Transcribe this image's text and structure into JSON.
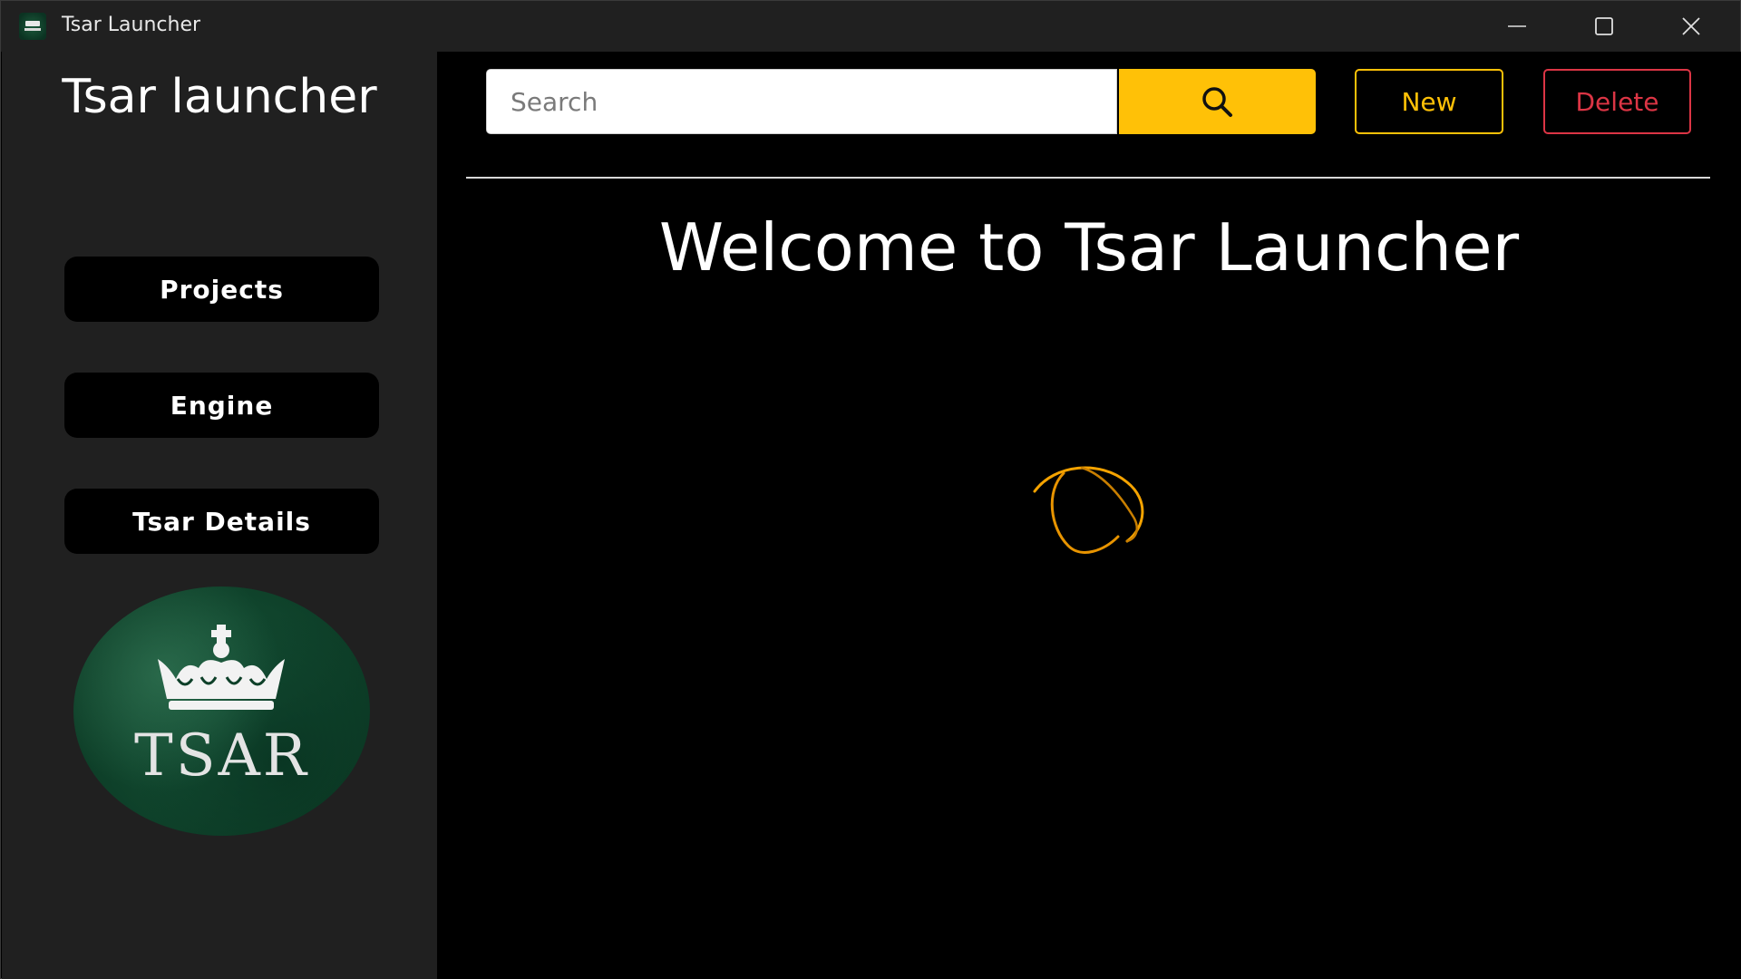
{
  "window": {
    "title": "Tsar Launcher",
    "icon": "tsar-app-icon",
    "controls": {
      "minimize": "minimize-icon",
      "maximize": "maximize-icon",
      "close": "close-icon"
    }
  },
  "sidebar": {
    "brand_title": "Tsar launcher",
    "items": [
      {
        "label": "Projects"
      },
      {
        "label": "Engine"
      },
      {
        "label": "Tsar Details"
      }
    ],
    "logo": {
      "text": "TSAR",
      "icon": "crown-icon",
      "color": "#0e4029"
    }
  },
  "toolbar": {
    "search_placeholder": "Search",
    "search_value": "",
    "search_icon": "search-icon",
    "new_label": "New",
    "delete_label": "Delete",
    "colors": {
      "accent": "#ffc107",
      "danger": "#dc3545"
    }
  },
  "main": {
    "welcome": "Welcome to Tsar Launcher",
    "loading_indicator": "loading-spinner-icon"
  },
  "colors": {
    "sidebar_bg": "#202020",
    "main_bg": "#000000",
    "text": "#ffffff"
  }
}
